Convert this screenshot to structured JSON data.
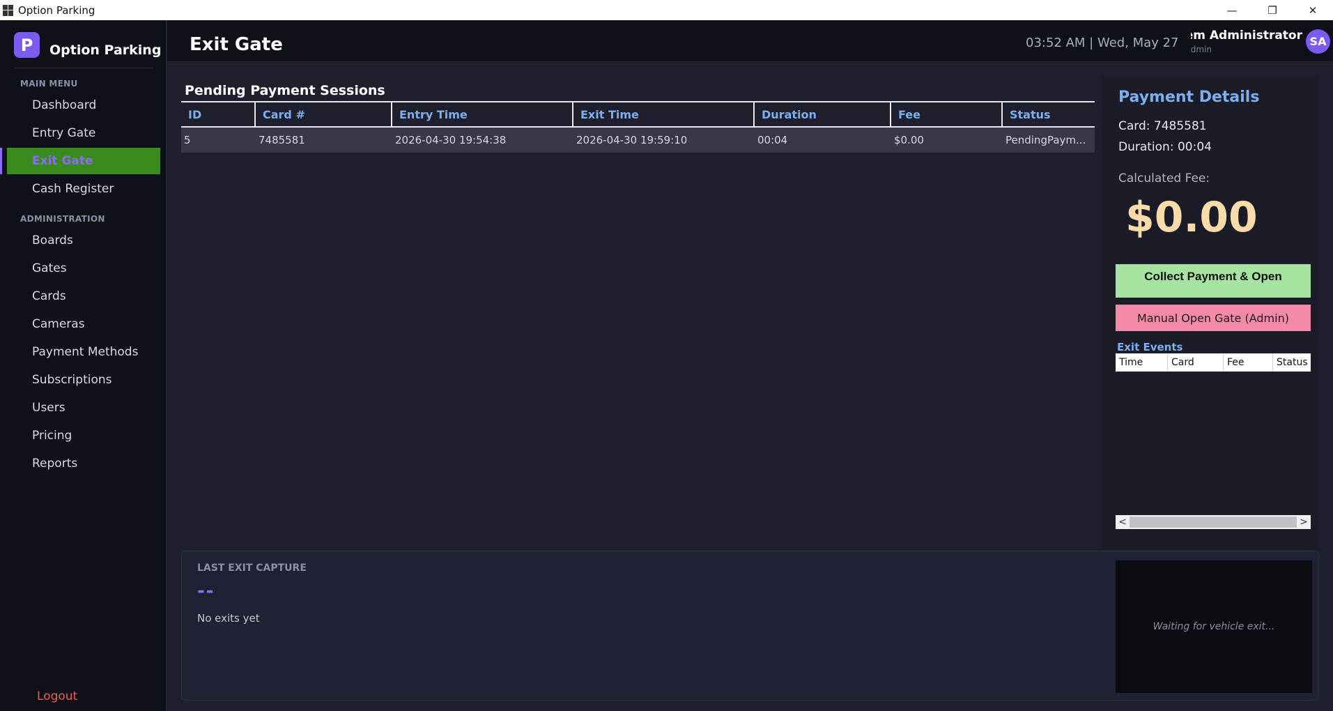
{
  "window": {
    "title": "Option Parking",
    "minimize": "—",
    "restore": "❐",
    "close": "✕"
  },
  "sidebar": {
    "brand_letter": "P",
    "brand_name": "Option Parking",
    "main_menu_label": "MAIN MENU",
    "main_items": [
      {
        "label": "Dashboard"
      },
      {
        "label": "Entry Gate"
      },
      {
        "label": "Exit Gate",
        "active": true
      },
      {
        "label": "Cash Register"
      }
    ],
    "admin_label": "ADMINISTRATION",
    "admin_items": [
      {
        "label": "Boards"
      },
      {
        "label": "Gates"
      },
      {
        "label": "Cards"
      },
      {
        "label": "Cameras"
      },
      {
        "label": "Payment Methods"
      },
      {
        "label": "Subscriptions"
      },
      {
        "label": "Users"
      },
      {
        "label": "Pricing"
      },
      {
        "label": "Reports"
      }
    ],
    "logout": "Logout"
  },
  "header": {
    "title": "Exit Gate",
    "clock": "03:52 AM  |  Wed, May 27",
    "user_name": "System Administrator",
    "user_role": "Admin",
    "avatar_initials": "SA"
  },
  "pending": {
    "title": "Pending Payment Sessions",
    "columns": [
      "ID",
      "Card #",
      "Entry Time",
      "Exit Time",
      "Duration",
      "Fee",
      "Status"
    ],
    "rows": [
      {
        "id": "5",
        "card": "7485581",
        "entry": "2026-04-30 19:54:38",
        "exit": "2026-04-30 19:59:10",
        "duration": "00:04",
        "fee": "$0.00",
        "status": "PendingPaym..."
      }
    ]
  },
  "payment": {
    "title": "Payment Details",
    "card": "Card: 7485581",
    "duration": "Duration: 00:04",
    "fee_label": "Calculated Fee:",
    "fee": "$0.00",
    "collect_label": "Collect Payment & Open",
    "manual_label": "Manual Open Gate (Admin)",
    "events_title": "Exit Events",
    "events_columns": [
      "Time",
      "Card",
      "Fee",
      "Status"
    ],
    "scroll_left": "<",
    "scroll_right": ">"
  },
  "capture": {
    "label": "LAST EXIT CAPTURE",
    "plate": "--",
    "text": "No exits yet",
    "image_placeholder": "Waiting for vehicle exit..."
  },
  "colors": {
    "accent": "#7c5cf0",
    "active_nav": "#3a8b1e",
    "heading_blue": "#7ab0ef",
    "collect_green": "#a6e3a1",
    "manual_pink": "#f38ba8",
    "fee_gold": "#f7dcaa",
    "logout_red": "#f05a5a"
  }
}
